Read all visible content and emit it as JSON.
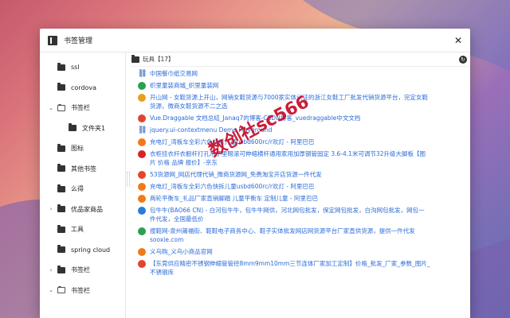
{
  "window": {
    "title": "书签管理"
  },
  "sidebar": {
    "items": [
      {
        "label": "ssl",
        "arrow": "",
        "open": false,
        "child": false
      },
      {
        "label": "cordova",
        "arrow": "",
        "open": false,
        "child": false
      },
      {
        "label": "书签栏",
        "arrow": "⌄",
        "open": true,
        "child": false
      },
      {
        "label": "文件夹1",
        "arrow": "",
        "open": false,
        "child": true
      },
      {
        "label": "图标",
        "arrow": "",
        "open": false,
        "child": false
      },
      {
        "label": "其他书签",
        "arrow": "",
        "open": false,
        "child": false
      },
      {
        "label": "么得",
        "arrow": "",
        "open": false,
        "child": false
      },
      {
        "label": "优品家商品",
        "arrow": "›",
        "open": false,
        "child": false
      },
      {
        "label": "工具",
        "arrow": "",
        "open": false,
        "child": false
      },
      {
        "label": "spring cloud",
        "arrow": "",
        "open": false,
        "child": false
      },
      {
        "label": "书签栏",
        "arrow": "›",
        "open": false,
        "child": false
      },
      {
        "label": "书签栏",
        "arrow": "⌄",
        "open": true,
        "child": false
      }
    ]
  },
  "main": {
    "header": "玩具【17】",
    "bookmarks": [
      {
        "text": "中国餐巾纸交易网",
        "icon": "link-icon",
        "color": ""
      },
      {
        "text": "织里童装商城_织里童装网",
        "icon": "site-favicon",
        "color": "#2aa050"
      },
      {
        "text": "开山网 - 女鞋货源上开山，网销女鞋货源与7000家实体认证的浙江女鞋工厂批发代销货源平台，完定女鞋货源，微商女鞋货源不二之选",
        "icon": "site-favicon",
        "color": "#e8a020"
      },
      {
        "text": "Vue.Draggable 文档总结_Janaq7的博客-CSDN博客_vuedraggable中文文档",
        "icon": "site-favicon",
        "color": "#e0452a"
      },
      {
        "text": "jquery.ui-contextmenu Demo Playground",
        "icon": "link-icon",
        "color": ""
      },
      {
        "text": "充电灯_湾板车全彩六色快拆儿童usbd600rc/r欢灯 - 阿里巴巴",
        "icon": "site-favicon",
        "color": "#f07a1a"
      },
      {
        "text": "衣柜挂衣杆衣橱杆打孔吊子里眼滚可伸缩横杆通用家用加厚钢管固定 3.6-4.1米可调节32升级大脚板【图片 价格 品牌 报价】-京东",
        "icon": "site-favicon",
        "color": "#d8232a"
      },
      {
        "text": "53货源网_网店代理代销_微商货源网_免费淘宝开店货源一件代发",
        "icon": "site-favicon",
        "color": "#e8452a"
      },
      {
        "text": "充电灯_湾板车全彩六色快拆儿童usbd600rc/r欢灯 - 阿里巴巴",
        "icon": "site-favicon",
        "color": "#f07a1a"
      },
      {
        "text": "两轮平衡车_礼品厂家直销脚踏 儿童平衡车 定制儿童 - 阿里巴巴",
        "icon": "site-favicon",
        "color": "#f07a1a"
      },
      {
        "text": "包牛牛(BAO66 CN) - 白河包牛牛，包牛牛网供，河北网包批发，保定网包批发，白沟网包批发，网包一件代发，全国最低价",
        "icon": "site-favicon",
        "color": "#2b7bd8"
      },
      {
        "text": "搜鞋网-泉州莆福街、鞋鞋电子商务中心、鞋子实体批发网店网货源平台厂家直供货源，提供一件代发 sooxie.com",
        "icon": "site-favicon",
        "color": "#2aa050"
      },
      {
        "text": "义乌购_义乌小商品官网",
        "icon": "site-favicon",
        "color": "#f07a1a"
      },
      {
        "text": "【东莞供应精密不锈钢伸缩管管径8mm9mm10mm三节连体厂家加工定制】价格_批发_厂家_参数_图片_不锈钢库",
        "icon": "site-favicon",
        "color": "#e0452a"
      }
    ]
  },
  "watermark": "数创社sc566"
}
